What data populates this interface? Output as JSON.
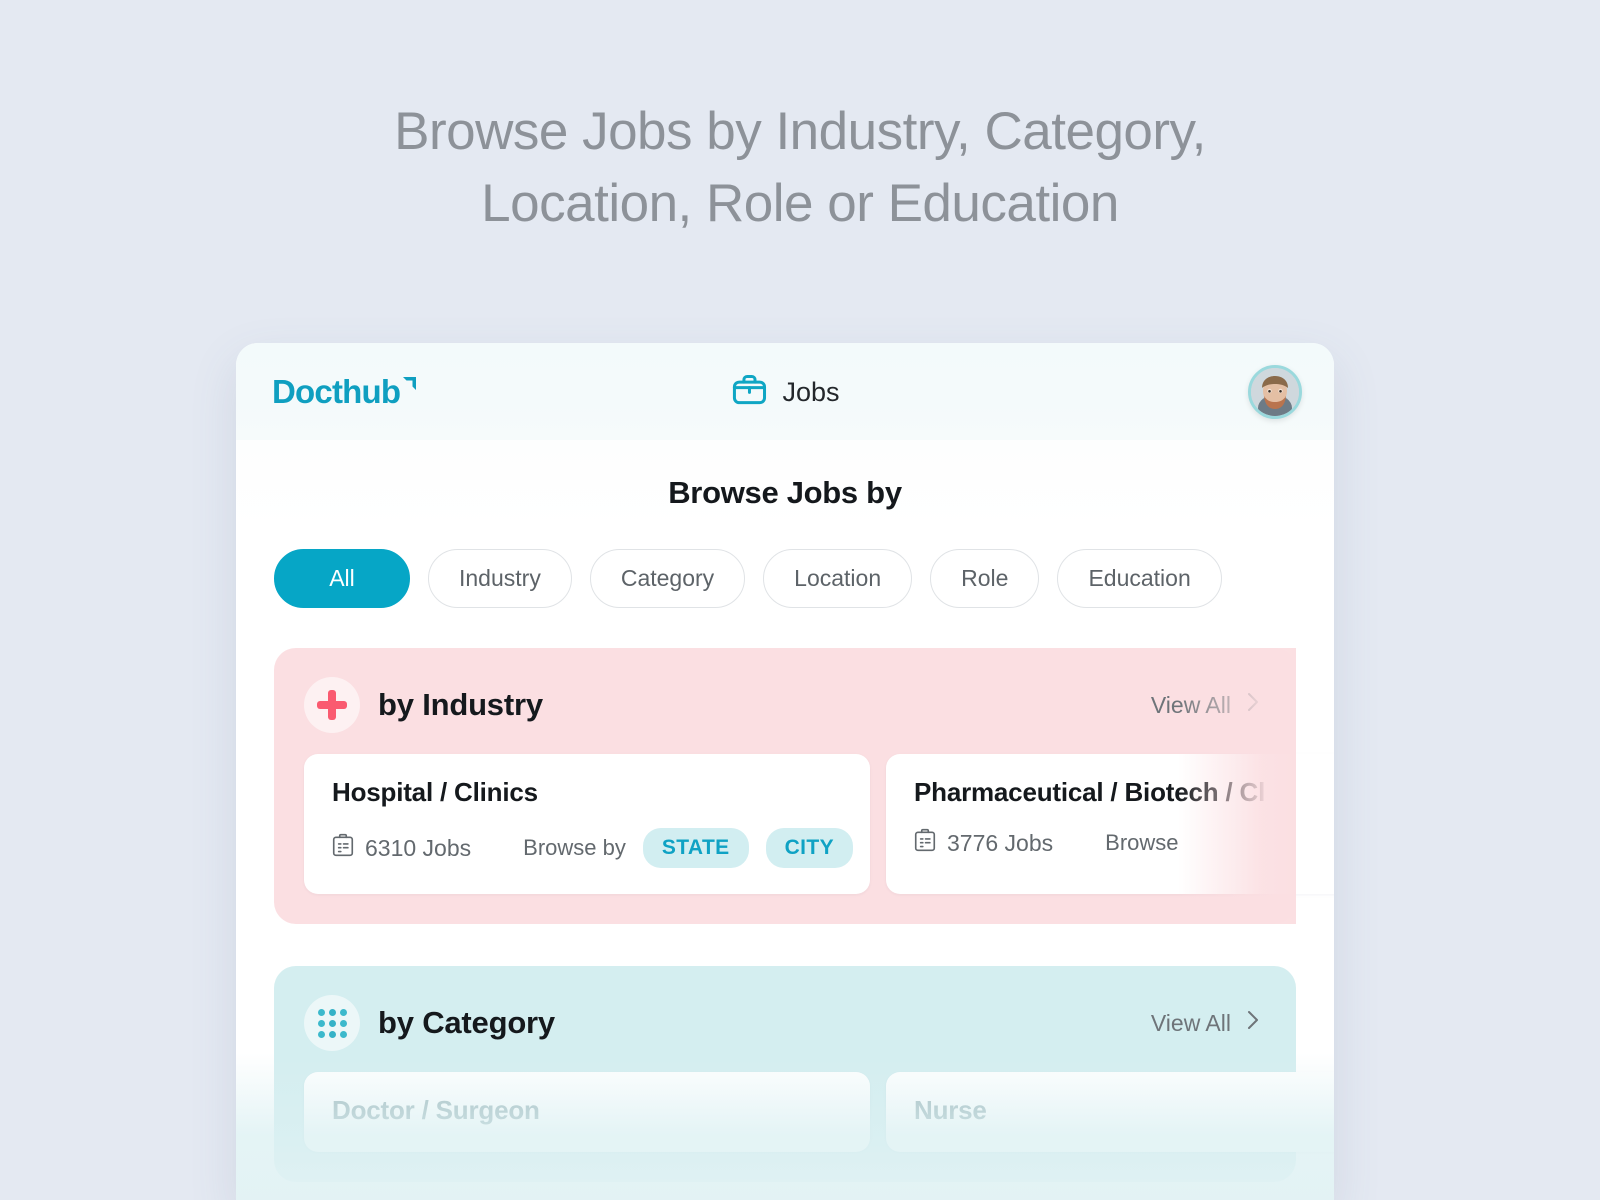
{
  "hero": {
    "line1": "Browse Jobs by Industry, Category,",
    "line2": "Location, Role or Education"
  },
  "app": {
    "brand": "Docthub",
    "nav_label": "Jobs",
    "avatar_name": "user-avatar"
  },
  "main": {
    "section_heading": "Browse Jobs by",
    "view_all_label": "View All"
  },
  "pills": [
    {
      "label": "All",
      "active": true
    },
    {
      "label": "Industry",
      "active": false
    },
    {
      "label": "Category",
      "active": false
    },
    {
      "label": "Location",
      "active": false
    },
    {
      "label": "Role",
      "active": false
    },
    {
      "label": "Education",
      "active": false
    }
  ],
  "groups": [
    {
      "key": "industry",
      "title": "by Industry",
      "icon": "plus-icon",
      "accent": "#fa5a70",
      "background": "#fbdfe2",
      "items": [
        {
          "title": "Hospital / Clinics",
          "jobs": "6310 Jobs",
          "browse_by": "Browse by",
          "tags": [
            "STATE",
            "CITY"
          ]
        },
        {
          "title": "Pharmaceutical / Biotech / Cl",
          "jobs": "3776 Jobs",
          "browse_by": "Browse",
          "tags": []
        }
      ]
    },
    {
      "key": "category",
      "title": "by Category",
      "icon": "grid-dots-icon",
      "accent": "#3cb9cc",
      "background": "#d4eef0",
      "items": [
        {
          "title": "Doctor / Surgeon",
          "jobs": "",
          "browse_by": "",
          "tags": []
        },
        {
          "title": "Nurse",
          "jobs": "",
          "browse_by": "",
          "tags": []
        }
      ]
    }
  ],
  "colors": {
    "page_background": "#e4e9f2",
    "brand_teal": "#0f9fc0",
    "active_pill": "#06a6c6",
    "tag_text": "#0fa2c4",
    "tag_background": "#d2eef1"
  }
}
